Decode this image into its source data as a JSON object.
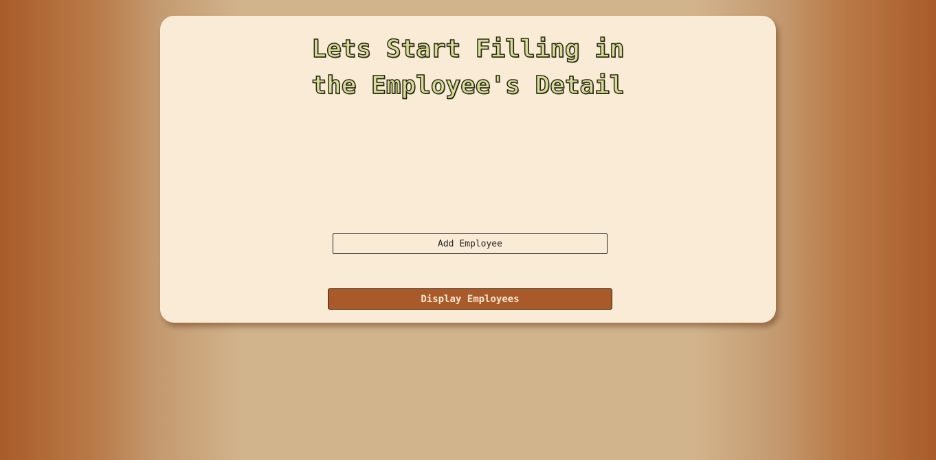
{
  "header": {
    "title_line1": "Lets Start Filling in",
    "title_line2": "the Employee's Detail"
  },
  "actions": {
    "add_label": "Add Employee",
    "display_label": "Display Employees"
  },
  "colors": {
    "page_edge": "#a95c2a",
    "page_center": "#d2b48c",
    "card_background": "#faebd7",
    "title_fill": "#d8dd9c",
    "display_button": "#a95a28"
  }
}
